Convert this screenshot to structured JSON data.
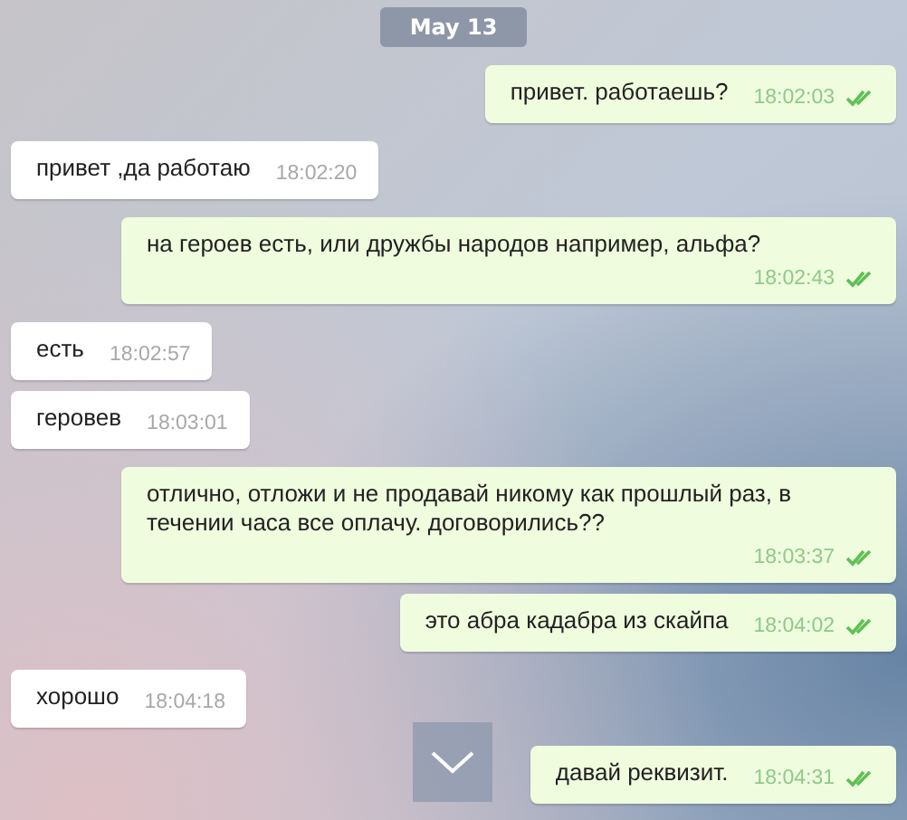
{
  "date_badge": "May 13",
  "messages": [
    {
      "outgoing": true,
      "text": "привет. работаешь?",
      "time": "18:02:03",
      "read": true
    },
    {
      "outgoing": false,
      "text": "привет ,да работаю",
      "time": "18:02:20"
    },
    {
      "outgoing": true,
      "text": "на героев есть, или дружбы народов например, альфа?",
      "time": "18:02:43",
      "read": true
    },
    {
      "outgoing": false,
      "text": "есть",
      "time": "18:02:57"
    },
    {
      "outgoing": false,
      "text": "геровев",
      "time": "18:03:01"
    },
    {
      "outgoing": true,
      "text": "отлично, отложи и не продавай никому как прошлый раз, в течении часа все оплачу. договорились??",
      "time": "18:03:37",
      "read": true
    },
    {
      "outgoing": true,
      "text": "это абра кадабра из скайпа",
      "time": "18:04:02",
      "read": true
    },
    {
      "outgoing": false,
      "text": "хорошо",
      "time": "18:04:18"
    },
    {
      "outgoing": true,
      "text": "давай реквизит.",
      "time": "18:04:31",
      "read": true
    }
  ]
}
